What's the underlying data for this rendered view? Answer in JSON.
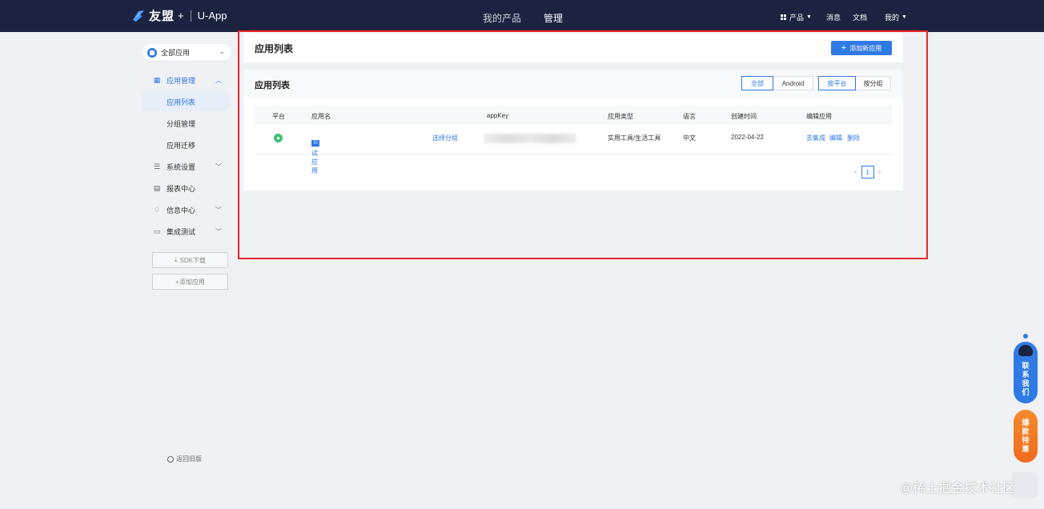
{
  "topbar": {
    "brand": "友盟",
    "plus": "+",
    "app_name": "U-App",
    "nav": [
      {
        "label": "我的产品"
      },
      {
        "label": "管理"
      }
    ],
    "right": {
      "products": "产品",
      "messages": "消息",
      "docs": "文档",
      "mine": "我的"
    }
  },
  "sidebar": {
    "app_select": "全部应用",
    "items": [
      {
        "label": "应用管理"
      },
      {
        "label": "应用列表"
      },
      {
        "label": "分组管理"
      },
      {
        "label": "应用迁移"
      },
      {
        "label": "系统设置"
      },
      {
        "label": "报表中心"
      },
      {
        "label": "信息中心"
      },
      {
        "label": "集成测试"
      }
    ],
    "sdk_download": "SDK下载",
    "add_app": "+添加应用",
    "back_old": "返回旧版"
  },
  "main": {
    "header_title": "应用列表",
    "add_new_app": "添加新应用",
    "list_title": "应用列表",
    "platform_filter": [
      "全部",
      "Android"
    ],
    "group_filter": [
      "按平台",
      "按分组"
    ],
    "columns": [
      "平台",
      "应用名",
      "appKey",
      "应用类型",
      "语言",
      "创建时间",
      "编辑应用"
    ],
    "rows": [
      {
        "badge": "AI",
        "app_name": "测试应用",
        "select_group": "选择分组",
        "app_type": "实用工具/生活工具",
        "language": "中文",
        "created": "2022-04-22",
        "actions": [
          "去集成",
          "编辑",
          "删除"
        ]
      }
    ],
    "pagination": {
      "current": "1"
    }
  },
  "floating": {
    "contact": [
      "联",
      "系",
      "我",
      "们"
    ],
    "deal": [
      "爆",
      "款",
      "特",
      "惠"
    ]
  },
  "watermark": "@稀土掘金技术社区",
  "colors": {
    "accent": "#2f7ae5",
    "topbar": "#1b2340",
    "highlight": "#e8272a",
    "android": "#3dbf74"
  }
}
